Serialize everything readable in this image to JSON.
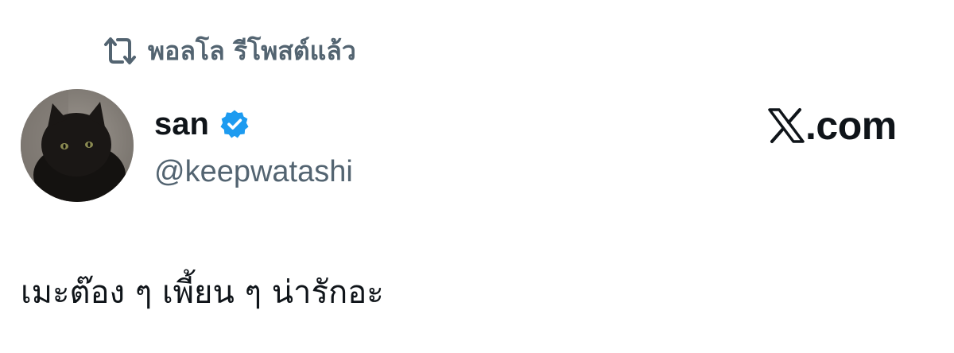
{
  "repost": {
    "icon": "repost-icon",
    "text": "พอลโล รีโพสต์แล้ว"
  },
  "author": {
    "avatar": "black-cat-avatar",
    "display_name": "san",
    "verified_icon": "verified-badge-icon",
    "verified_color": "#1d9bf0",
    "handle": "@keepwatashi"
  },
  "site": {
    "logo": "x-logo-icon",
    "label": ".com"
  },
  "post": {
    "text": "เมะต๊อง ๆ เพี้ยน ๆ น่ารักอะ"
  },
  "colors": {
    "primary_text": "#0f1419",
    "secondary_text": "#536471",
    "background": "#ffffff"
  }
}
